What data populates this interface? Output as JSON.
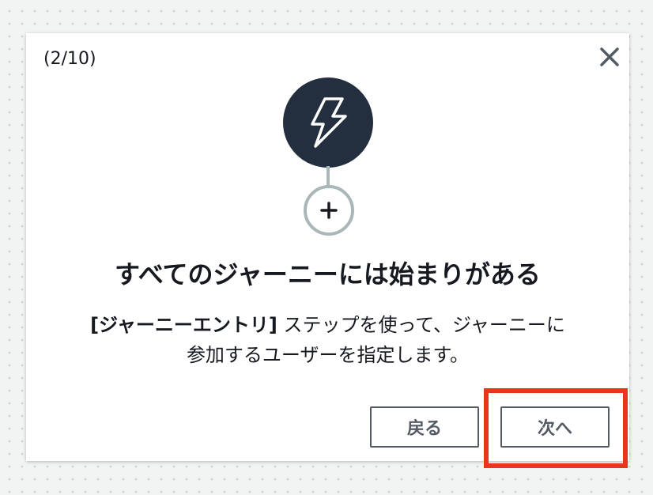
{
  "modal": {
    "step_counter": "(2/10)",
    "close_icon": "close-icon",
    "entry_icon": "lightning-bolt-icon",
    "add_icon": "plus-icon",
    "title": "すべてのジャーニーには始まりがある",
    "description": {
      "bold": "[ジャーニーエントリ]",
      "line1_rest": " ステップを使って、ジャーニーに",
      "line2": "参加するユーザーを指定します。"
    },
    "buttons": {
      "back_label": "戻る",
      "next_label": "次へ"
    }
  },
  "colors": {
    "entry_circle": "#232f3e",
    "connector": "#aab7b8",
    "button_border": "#545b64",
    "highlight": "#e8361d"
  }
}
